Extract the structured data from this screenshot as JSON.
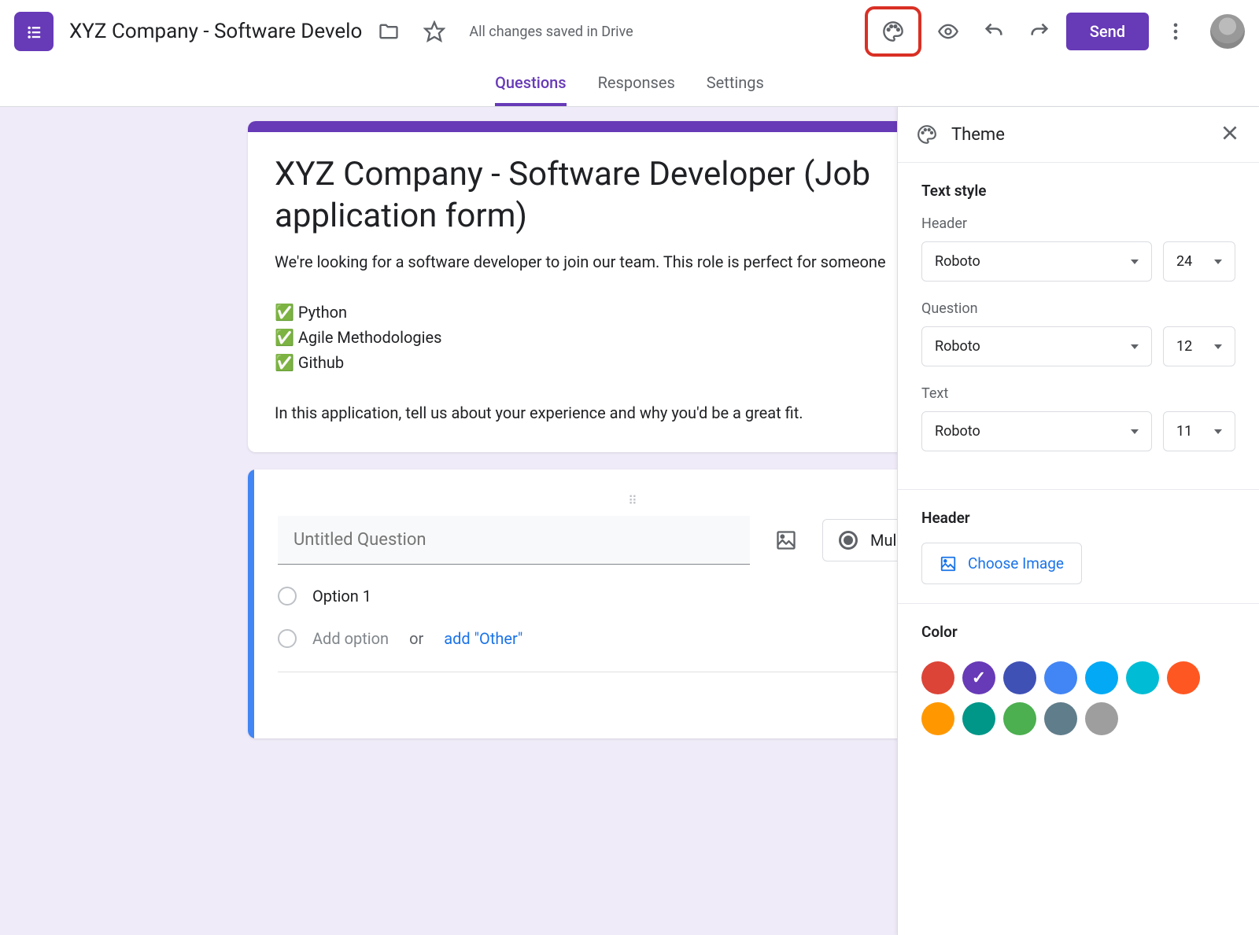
{
  "header": {
    "doc_title": "XYZ Company - Software Develo",
    "save_status": "All changes saved in Drive",
    "send_label": "Send"
  },
  "tabs": {
    "questions": "Questions",
    "responses": "Responses",
    "settings": "Settings"
  },
  "form": {
    "title": "XYZ Company - Software Developer (Job application form)",
    "description": "We're looking for a software developer to join our team. This role is perfect for someone\n\n✅ Python\n✅ Agile Methodologies\n✅ Github\n\n In this application, tell us about your experience and why you'd be a great fit."
  },
  "question": {
    "title_placeholder": "Untitled Question",
    "type_label": "Mul",
    "option1": "Option 1",
    "add_option": "Add option",
    "or": "or",
    "add_other": "add \"Other\""
  },
  "theme": {
    "panel_title": "Theme",
    "text_style_title": "Text style",
    "header_label": "Header",
    "question_label": "Question",
    "text_label": "Text",
    "header_font": "Roboto",
    "header_size": "24",
    "question_font": "Roboto",
    "question_size": "12",
    "text_font": "Roboto",
    "text_size": "11",
    "header_section_title": "Header",
    "choose_image": "Choose Image",
    "color_title": "Color",
    "colors": [
      "#db4437",
      "#673ab7",
      "#3f51b5",
      "#4285f4",
      "#03a9f4",
      "#00bcd4",
      "#ff5722",
      "#ff9800",
      "#009688",
      "#4caf50",
      "#607d8b",
      "#9e9e9e"
    ],
    "selected_color_index": 1
  }
}
